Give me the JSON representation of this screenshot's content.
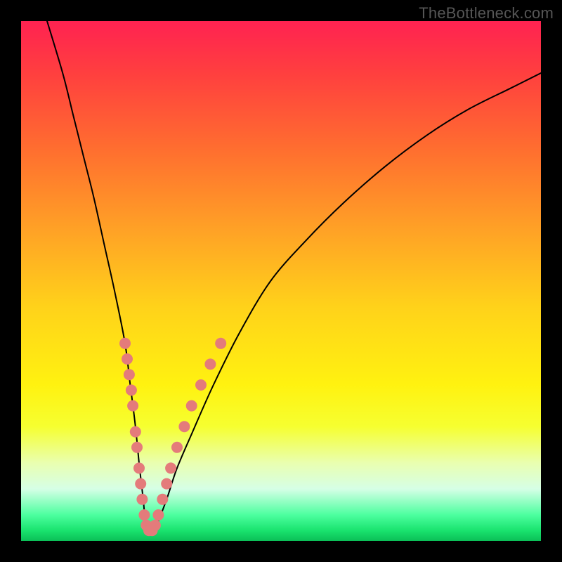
{
  "watermark": "TheBottleneck.com",
  "colors": {
    "background_frame": "#000000",
    "curve_stroke": "#000000",
    "marker_fill": "#e47b7b",
    "gradient_top": "#ff2251",
    "gradient_mid": "#ffd21a",
    "gradient_bottom": "#0bbf57"
  },
  "chart_data": {
    "type": "line",
    "title": "",
    "xlabel": "",
    "ylabel": "",
    "xlim": [
      0,
      100
    ],
    "ylim": [
      0,
      100
    ],
    "grid": false,
    "legend": false,
    "series": [
      {
        "name": "bottleneck-curve",
        "x": [
          5,
          8,
          10,
          12,
          14,
          16,
          18,
          20,
          21,
          22,
          22.8,
          23.5,
          24,
          25,
          26,
          28,
          30,
          33,
          37,
          42,
          48,
          55,
          62,
          70,
          78,
          86,
          94,
          100
        ],
        "y": [
          100,
          90,
          82,
          74,
          66,
          57,
          48,
          38,
          30,
          22,
          14,
          8,
          3,
          2,
          3,
          8,
          14,
          21,
          30,
          40,
          50,
          58,
          65,
          72,
          78,
          83,
          87,
          90
        ]
      }
    ],
    "markers": {
      "name": "highlighted-points",
      "points": [
        {
          "x": 20.0,
          "y": 38
        },
        {
          "x": 20.4,
          "y": 35
        },
        {
          "x": 20.8,
          "y": 32
        },
        {
          "x": 21.2,
          "y": 29
        },
        {
          "x": 21.5,
          "y": 26
        },
        {
          "x": 22.0,
          "y": 21
        },
        {
          "x": 22.3,
          "y": 18
        },
        {
          "x": 22.7,
          "y": 14
        },
        {
          "x": 23.0,
          "y": 11
        },
        {
          "x": 23.3,
          "y": 8
        },
        {
          "x": 23.7,
          "y": 5
        },
        {
          "x": 24.1,
          "y": 3
        },
        {
          "x": 24.6,
          "y": 2
        },
        {
          "x": 25.2,
          "y": 2
        },
        {
          "x": 25.8,
          "y": 3
        },
        {
          "x": 26.4,
          "y": 5
        },
        {
          "x": 27.2,
          "y": 8
        },
        {
          "x": 28.0,
          "y": 11
        },
        {
          "x": 28.8,
          "y": 14
        },
        {
          "x": 30.0,
          "y": 18
        },
        {
          "x": 31.4,
          "y": 22
        },
        {
          "x": 32.8,
          "y": 26
        },
        {
          "x": 34.6,
          "y": 30
        },
        {
          "x": 36.4,
          "y": 34
        },
        {
          "x": 38.4,
          "y": 38
        }
      ]
    }
  }
}
